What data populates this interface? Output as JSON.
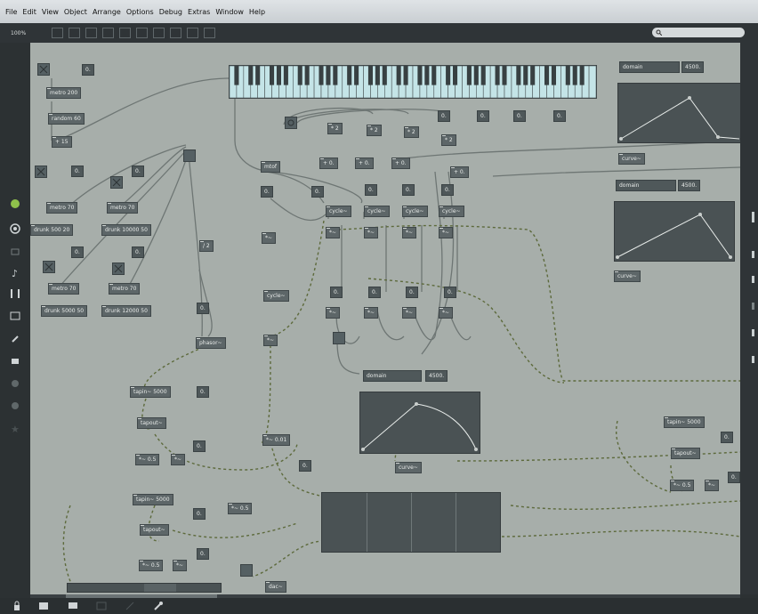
{
  "menubar": {
    "items": [
      "File",
      "Edit",
      "View",
      "Object",
      "Arrange",
      "Options",
      "Debug",
      "Extras",
      "Window",
      "Help"
    ]
  },
  "toolbar": {
    "zoom": "100%",
    "search_placeholder": ""
  },
  "patch": {
    "metro_top": "metro 200",
    "random": "random 60",
    "plus15": "+ 15",
    "num_top": "0.",
    "metro_a": "metro 70",
    "metro_b": "metro 70",
    "metro_c": "metro 70",
    "metro_d": "metro 70",
    "drunk_a": "drunk 500 20",
    "drunk_b": "drunk 10000 50",
    "drunk_c": "drunk 5000 50",
    "drunk_d": "drunk 12000 50",
    "num_a": "0.",
    "num_b": "0.",
    "num_c": "0.",
    "num_d": "0.",
    "mtof": "mtof",
    "num_mtof": "0.",
    "div2": "/ 2",
    "num_phasor_in": "0.",
    "phasor": "phasor~",
    "times_small": "*~",
    "cycle_main": "cycle~",
    "times_main": "*~",
    "times_top": [
      "* 2",
      "* 2",
      "* 2",
      "* 2"
    ],
    "plus_row": [
      "+ 0.",
      "+ 0.",
      "+ 0.",
      "+ 0."
    ],
    "num_row1": [
      "0.",
      "0.",
      "0.",
      "0."
    ],
    "num_row2": [
      "0.",
      "0.",
      "0.",
      "0."
    ],
    "num_row3": [
      "0.",
      "0.",
      "0."
    ],
    "cycles": [
      "cycle~",
      "cycle~",
      "cycle~",
      "cycle~"
    ],
    "times_row": [
      "*~",
      "*~",
      "*~",
      "*~"
    ],
    "times_row2": [
      "*~",
      "*~",
      "*~",
      "*~"
    ],
    "num_mid": [
      "0.",
      "0.",
      "0.",
      "0."
    ],
    "tapin_a": "tapin~ 5000",
    "tapout_a": "tapout~",
    "times_a": "*~ 0.5",
    "times_a2": "*~",
    "num_tap_a": "0.",
    "num_tap_a2": "0.",
    "tapin_b": "tapin~ 5000",
    "tapout_b": "tapout~",
    "times_b": "*~ 0.5",
    "times_b2": "*~",
    "num_tap_b": "0.",
    "num_tap_b2": "0.",
    "times_05_mid": "*~ 0.5",
    "times_001": "*~ 0.01",
    "num_001": "0.",
    "tapin_c": "tapin~ 5000",
    "tapout_c": "tapout~",
    "times_c": "*~ 0.5",
    "times_c2": "*~",
    "num_tap_c": "0.",
    "num_tap_c2": "0.",
    "dac_partial": "dac~",
    "env1": {
      "domain_label": "domain",
      "domain_value": "4500.",
      "curve": "curve~"
    },
    "env2": {
      "domain_label": "domain",
      "domain_value": "4500.",
      "curve": "curve~"
    },
    "env3": {
      "domain_label": "domain",
      "domain_value": "4500.",
      "curve": "curve~"
    }
  }
}
